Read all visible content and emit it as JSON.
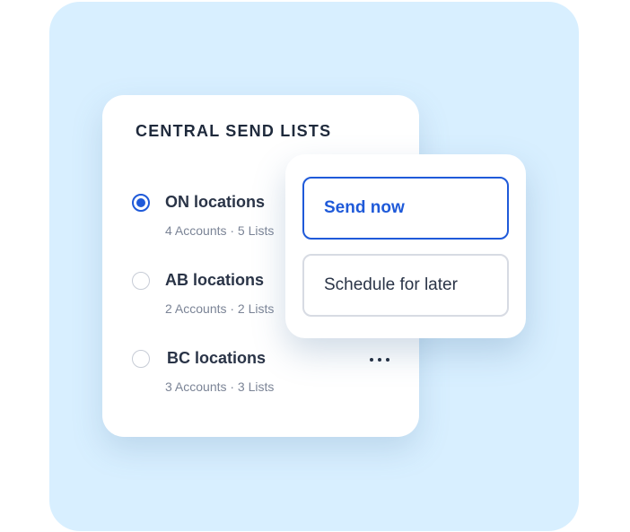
{
  "send_lists": {
    "title": "CENTRAL SEND LISTS",
    "items": [
      {
        "name": "ON locations",
        "meta": "4 Accounts · 5 Lists",
        "selected": true
      },
      {
        "name": "AB locations",
        "meta": "2 Accounts · 2 Lists",
        "selected": false
      },
      {
        "name": "BC locations",
        "meta": "3 Accounts · 3 Lists",
        "selected": false
      }
    ],
    "more_icon": "more-horizontal-icon"
  },
  "send_options": {
    "send_now_label": "Send now",
    "schedule_label": "Schedule for later"
  },
  "colors": {
    "background_panel": "#d8efff",
    "accent": "#1f5ad9",
    "text_primary": "#2a3447",
    "text_secondary": "#7b8496"
  }
}
